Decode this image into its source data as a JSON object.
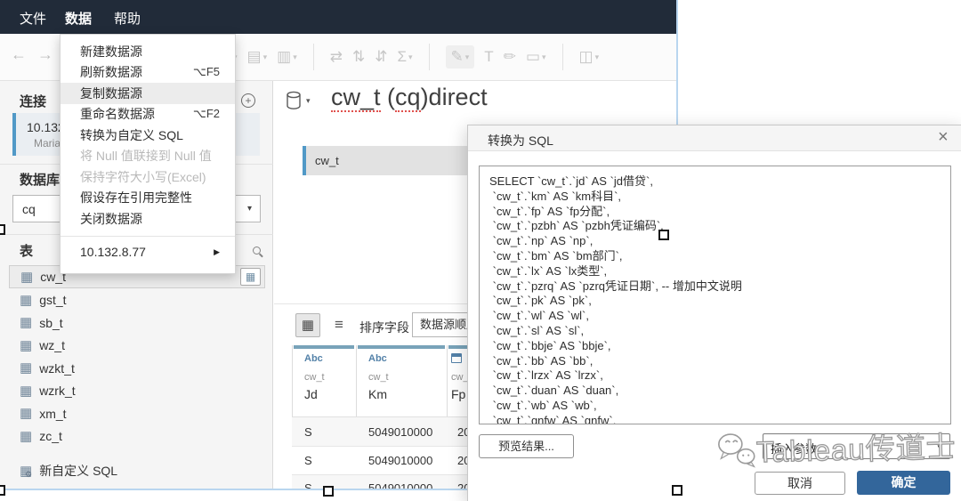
{
  "menubar": {
    "file": "文件",
    "data": "数据",
    "help": "帮助"
  },
  "toolbar": {
    "back": "←",
    "forward": "→",
    "icons": [
      "▾",
      "▤",
      "▥",
      "⇄",
      "⇅",
      "⇵",
      "Σ",
      "✎",
      "T",
      "✏",
      "▭",
      "◫"
    ]
  },
  "data_menu": {
    "items": [
      {
        "label": "新建数据源",
        "shortcut": ""
      },
      {
        "label": "刷新数据源",
        "shortcut": "⌥F5"
      },
      {
        "label": "复制数据源",
        "shortcut": ""
      },
      {
        "label": "重命名数据源",
        "shortcut": "⌥F2"
      },
      {
        "label": "转换为自定义 SQL",
        "shortcut": ""
      },
      {
        "label": "将 Null 值联接到 Null 值",
        "shortcut": ""
      },
      {
        "label": "保持字符大小写(Excel)",
        "shortcut": ""
      },
      {
        "label": "假设存在引用完整性",
        "shortcut": ""
      },
      {
        "label": "关闭数据源",
        "shortcut": ""
      }
    ],
    "submenu": {
      "label": "10.132.8.77",
      "arrow": "▶"
    }
  },
  "sidebar": {
    "connections_header": "连接",
    "add_glyph": "+",
    "connection": {
      "name": "10.132",
      "subtitle": "Maria"
    },
    "database_label": "数据库",
    "database_value": "cq",
    "tables_header": "表",
    "tables": [
      "cw_t",
      "gst_t",
      "sb_t",
      "wz_t",
      "wzkt_t",
      "wzrk_t",
      "xm_t",
      "zc_t"
    ],
    "new_custom_sql": "新自定义 SQL",
    "table_icon_glyph": "▦",
    "gear_glyph": "⚙"
  },
  "canvas": {
    "title_segments": {
      "p1": "cw_t",
      "p2": " (",
      "p3": "cq",
      "p4": ")direct"
    },
    "chip": "cw_t"
  },
  "grid": {
    "grid_view_glyph": "▦",
    "list_view_glyph": "≡",
    "sort_label": "排序字段",
    "order_value": "数据源顺序",
    "columns": [
      {
        "type": "Abc",
        "table": "cw_t",
        "field": "Jd"
      },
      {
        "type": "Abc",
        "table": "cw_t",
        "field": "Km"
      },
      {
        "type": "date",
        "table": "cw_t",
        "field": "Fp"
      }
    ],
    "rows": [
      [
        "S",
        "5049010000",
        "20"
      ],
      [
        "S",
        "5049010000",
        "20"
      ],
      [
        "S",
        "5049010000",
        "20"
      ]
    ]
  },
  "dialog": {
    "title": "转换为 SQL",
    "close_glyph": "×",
    "sql_lines": [
      "SELECT `cw_t`.`jd` AS `jd借贷`,",
      " `cw_t`.`km` AS `km科目`,",
      " `cw_t`.`fp` AS `fp分配`,",
      " `cw_t`.`pzbh` AS `pzbh凭证编码`,",
      " `cw_t`.`np` AS `np`,",
      " `cw_t`.`bm` AS `bm部门`,",
      " `cw_t`.`lx` AS `lx类型`,",
      " `cw_t`.`pzrq` AS `pzrq凭证日期`, -- 增加中文说明",
      " `cw_t`.`pk` AS `pk`,",
      " `cw_t`.`wl` AS `wl`,",
      " `cw_t`.`sl` AS `sl`,",
      " `cw_t`.`bbje` AS `bbje`,",
      " `cw_t`.`bb` AS `bb`,",
      " `cw_t`.`lrzx` AS `lrzx`,",
      " `cw_t`.`duan` AS `duan`,",
      " `cw_t`.`wb` AS `wb`,",
      " `cw_t`.`gnfw` AS `gnfw`,"
    ],
    "preview_button": "预览结果...",
    "insert_param_label": "插入参数:",
    "cancel_button": "取消",
    "ok_button": "确定"
  },
  "watermark": {
    "text": "Tableau传道士"
  },
  "glyphs": {
    "caret": "▾"
  },
  "colors": {
    "topbar": "#212b39",
    "accent_blue": "#5199c7",
    "ok_button": "#33669b",
    "header_bar": "#78a3b9",
    "selection": "#b9d6ef",
    "squiggle": "#e0514d"
  }
}
